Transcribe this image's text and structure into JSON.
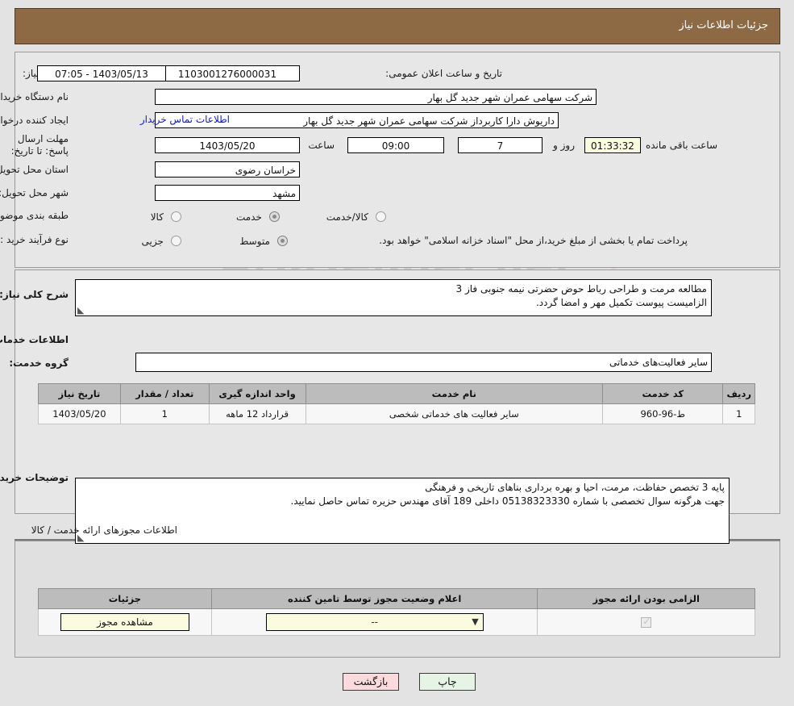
{
  "header": {
    "title": "جزئیات اطلاعات نیاز"
  },
  "form": {
    "need_number_label": "شماره نیاز:",
    "need_number_value": "1103001276000031",
    "announce_label": "تاریخ و ساعت اعلان عمومی:",
    "announce_value": "1403/05/13 - 07:05",
    "buyer_org_label": "نام دستگاه خریدار:",
    "buyer_org_value": "شرکت سهامی عمران شهر جدید گل بهار",
    "requester_label": "ایجاد کننده درخواست:",
    "requester_value": "داریوش دارا کاربرداز شرکت سهامی عمران شهر جدید گل بهار",
    "contact_link": "اطلاعات تماس خریدار",
    "deadline_label": "مهلت ارسال پاسخ: تا تاریخ:",
    "deadline_date": "1403/05/20",
    "time_label": "ساعت",
    "deadline_time": "09:00",
    "days_value": "7",
    "days_label": "روز و",
    "remaining_time": "01:33:32",
    "remaining_label": "ساعت باقی مانده",
    "province_label": "استان محل تحویل:",
    "province_value": "خراسان رضوی",
    "city_label": "شهر محل تحویل:",
    "city_value": "مشهد",
    "category_label": "طبقه بندی موضوعی:",
    "category_options": [
      {
        "label": "کالا",
        "selected": false
      },
      {
        "label": "خدمت",
        "selected": true
      },
      {
        "label": "کالا/خدمت",
        "selected": false
      }
    ],
    "process_label": "نوع فرآیند خرید :",
    "process_options": [
      {
        "label": "جزیی",
        "selected": false
      },
      {
        "label": "متوسط",
        "selected": true
      }
    ],
    "payment_note": "پرداخت تمام یا بخشی از مبلغ خرید،از محل \"اسناد خزانه اسلامی\" خواهد بود."
  },
  "description": {
    "label": "شرح کلی نیاز:",
    "line1": "مطالعه مرمت و طراحی رباط حوض حضرتی نیمه جنوبی فاز 3",
    "line2": "الزامیست پیوست تکمیل مهر و امضا گردد."
  },
  "services_section": {
    "title": "اطلاعات خدمات مورد نیاز",
    "group_label": "گروه خدمت:",
    "group_value": "سایر فعالیت‌های خدماتی",
    "table": {
      "headers": [
        "ردیف",
        "کد خدمت",
        "نام خدمت",
        "واحد اندازه گیری",
        "تعداد / مقدار",
        "تاریخ نیاز"
      ],
      "rows": [
        {
          "row": "1",
          "code": "ط-96-960",
          "name": "سایر فعالیت های خدماتی شخصی",
          "unit": "قرارداد 12 ماهه",
          "quantity": "1",
          "date": "1403/05/20"
        }
      ]
    }
  },
  "buyer_notes": {
    "label": "توضیحات خریدار:",
    "line1": "پایه 3 تخصص حفاظت، مرمت، احیا و بهره برداری بناهای تاریخی و فرهنگی",
    "line2": "جهت هرگونه سوال تخصصی با شماره 05138323330 داخلی 189 آقای مهندس حزیره تماس حاصل نمایید."
  },
  "permits_section": {
    "title": "اطلاعات مجوزهای ارائه خدمت / کالا",
    "table": {
      "headers": [
        "الزامی بودن ارائه مجوز",
        "اعلام وضعیت مجوز توسط تامین کننده",
        "جزئیات"
      ],
      "rows": [
        {
          "required_checked": true,
          "status_value": "--",
          "details_label": "مشاهده مجوز"
        }
      ]
    }
  },
  "footer": {
    "print_label": "چاپ",
    "back_label": "بازگشت"
  },
  "colors": {
    "header_bg": "#8d6a43",
    "link": "#1018c8",
    "back_button": "#fadadd",
    "print_button": "#e6f4e6",
    "highlight_field": "#fbfbe0"
  }
}
